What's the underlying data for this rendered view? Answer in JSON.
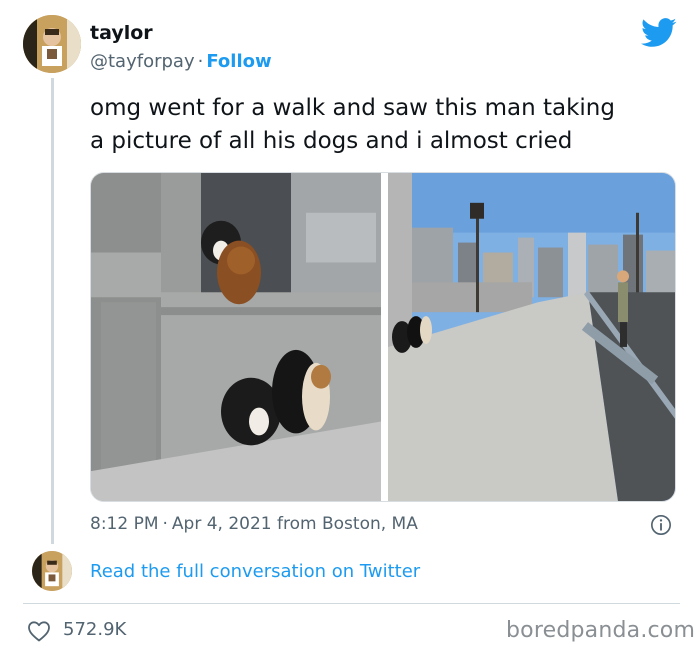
{
  "author": {
    "name": "taylor",
    "handle": "@tayforpay",
    "follow_label": "Follow"
  },
  "tweet": {
    "text_line_1": "omg went for a walk and saw this man taking",
    "text_line_2": "a picture of all his dogs and i almost cried",
    "time": "8:12 PM",
    "date": "Apr 4, 2021",
    "location": "from Boston, MA",
    "separator": "·"
  },
  "conversation_link": "Read the full conversation on Twitter",
  "stats": {
    "likes": "572.9K"
  },
  "watermark": "boredpanda.com",
  "icons": {
    "brand": "twitter-bird-icon",
    "info": "info-icon",
    "like": "heart-icon"
  },
  "colors": {
    "accent": "#1d9bf0",
    "text": "#0f1419",
    "muted": "#536471",
    "divider": "#cfd9de"
  }
}
